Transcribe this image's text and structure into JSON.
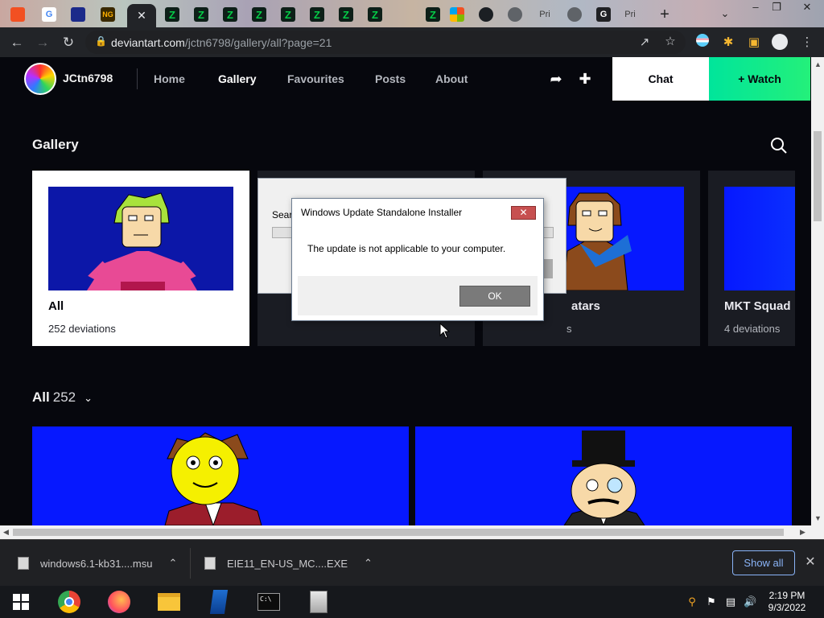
{
  "browser": {
    "tab_favicons": [
      {
        "name": "microsoft-favicon",
        "glyph": "▦"
      },
      {
        "name": "google-favicon",
        "glyph": "G"
      },
      {
        "name": "site-favicon",
        "glyph": "■"
      },
      {
        "name": "newgrounds-favicon",
        "glyph": "NG"
      },
      {
        "name": "deviantart-favicon",
        "glyph": "✕"
      },
      {
        "name": "deviantart-favicon",
        "glyph": "Z"
      },
      {
        "name": "deviantart-favicon",
        "glyph": "Z"
      },
      {
        "name": "deviantart-favicon",
        "glyph": "Z"
      },
      {
        "name": "deviantart-favicon",
        "glyph": "Z"
      },
      {
        "name": "deviantart-favicon",
        "glyph": "Z"
      },
      {
        "name": "deviantart-favicon",
        "glyph": "Z"
      },
      {
        "name": "deviantart-favicon",
        "glyph": "Z"
      },
      {
        "name": "deviantart-favicon",
        "glyph": "Z"
      },
      {
        "name": "deviantart-favicon",
        "glyph": "Z"
      },
      {
        "name": "microsoft-favicon",
        "glyph": "▦"
      },
      {
        "name": "github-favicon",
        "glyph": "●"
      },
      {
        "name": "github-favicon",
        "glyph": "●"
      }
    ],
    "tab_text_1": "Pri",
    "tab_text_2": "Pri",
    "tab_g": "G",
    "new_tab": "+",
    "url_host": "deviantart.com",
    "url_path": "/jctn6798/gallery/all?page=21"
  },
  "site": {
    "username": "JCtn6798",
    "nav": [
      "Home",
      "Gallery",
      "Favourites",
      "Posts",
      "About"
    ],
    "chat_label": "Chat",
    "watch_label": "+ Watch",
    "gallery_title": "Gallery",
    "folders": [
      {
        "name": "All",
        "count": "252 deviations"
      },
      {
        "name": "",
        "count": ""
      },
      {
        "name": "atars",
        "count": "s"
      },
      {
        "name": "MKT Squad",
        "count": "4 deviations"
      }
    ],
    "all_label": "All",
    "all_count": "252"
  },
  "dialog_back": {
    "label": "Searc"
  },
  "dialog": {
    "title": "Windows Update Standalone Installer",
    "close": "✕",
    "message": "The update is not applicable to your computer.",
    "ok_label": "OK"
  },
  "downloads": {
    "items": [
      {
        "name": "windows6.1-kb31....msu"
      },
      {
        "name": "EIE11_EN-US_MC....EXE"
      }
    ],
    "show_all": "Show all"
  },
  "taskbar": {
    "time": "2:19 PM",
    "date": "9/3/2022"
  },
  "colors": {
    "watch_green": "#00e59b",
    "card_blue": "#0618ff",
    "thumb_navy": "#0c17a8"
  }
}
